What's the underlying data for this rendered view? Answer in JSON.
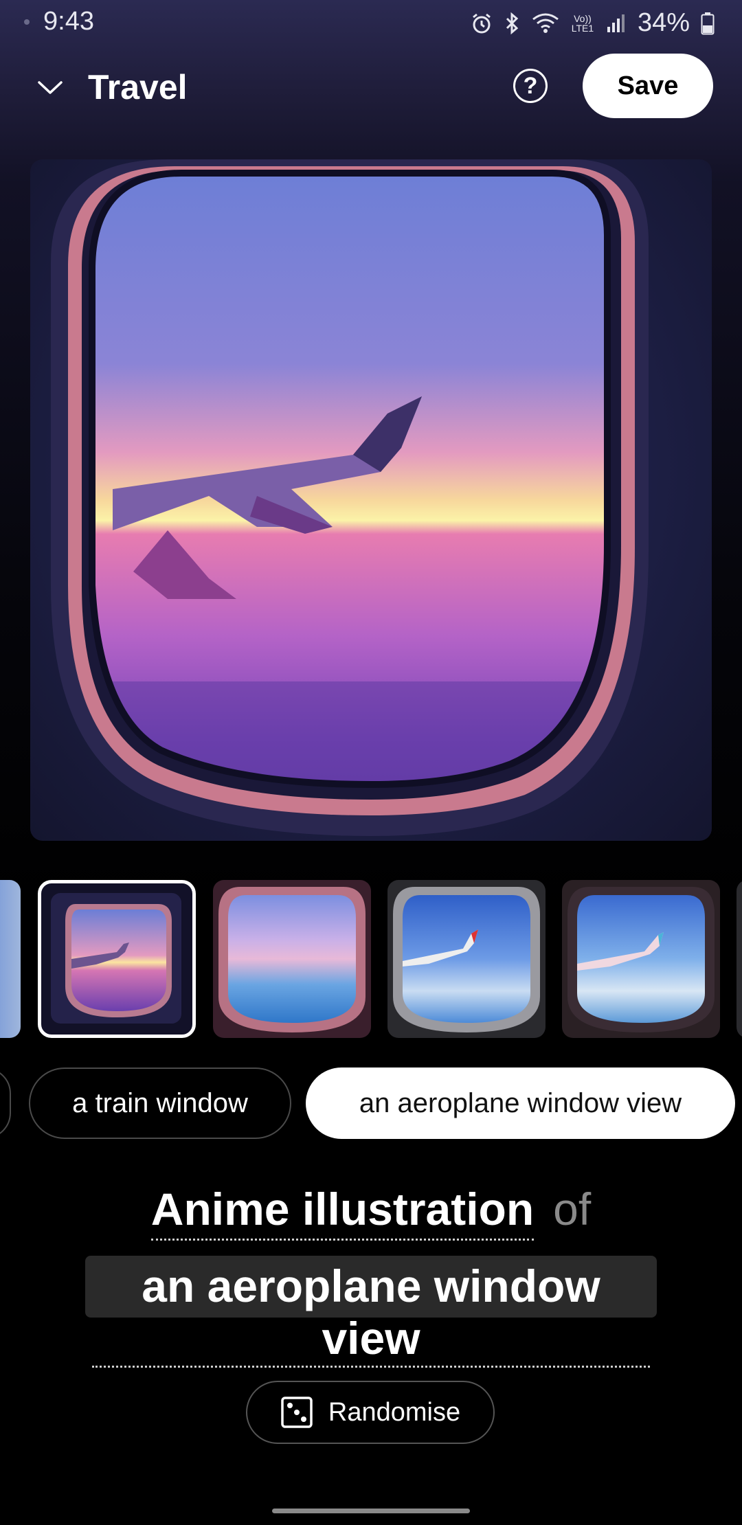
{
  "status_bar": {
    "time": "9:43",
    "battery_percent": "34%",
    "icons": [
      "alarm-icon",
      "bluetooth-icon",
      "wifi-icon",
      "volte-lte1-icon",
      "signal-icon",
      "battery-icon"
    ],
    "volte_label": "Vo)) LTE1"
  },
  "header": {
    "title": "Travel",
    "help_label": "?",
    "save_label": "Save"
  },
  "main_image": {
    "description_icon": "aeroplane-window-image"
  },
  "thumbnails": {
    "selected_index": 1,
    "count_visible": 6
  },
  "chips": [
    {
      "label": "a train window",
      "selected": false
    },
    {
      "label": "an aeroplane window view",
      "selected": true
    }
  ],
  "prompt": {
    "style": "Anime illustration",
    "connector": "of",
    "subject": "an aeroplane window view"
  },
  "randomise": {
    "label": "Randomise",
    "icon": "dice-icon"
  },
  "colors": {
    "accent_white": "#ffffff",
    "background": "#000000",
    "chip_border": "#4a4a4a",
    "subject_highlight": "#2a2a2a"
  }
}
